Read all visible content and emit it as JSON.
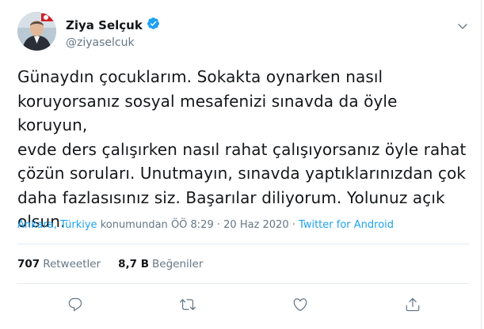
{
  "author": {
    "display_name": "Ziya Selçuk",
    "handle": "@ziyaselcuk",
    "verified": true,
    "avatar_icon": "profile-photo"
  },
  "tweet": {
    "text": "Günaydın çocuklarım. Sokakta oynarken nasıl\nkoruyorsanız sosyal mesafenizi sınavda da öyle koruyun,\nevde ders çalışırken nasıl rahat çalışıyorsanız öyle rahat\nçözün soruları. Unutmayın, sınavda yaptıklarınızdan çok\ndaha fazlasısınız siz. Başarılar diliyorum. Yolunuz açık\nolsun."
  },
  "meta": {
    "location": "Ankara, Türkiye",
    "location_suffix": "konumundan",
    "time": "ÖÖ 8:29",
    "separator": "·",
    "date": "20 Haz 2020",
    "source": "Twitter for Android"
  },
  "stats": {
    "retweets_count": "707",
    "retweets_label": "Retweetler",
    "likes_count": "8,7 B",
    "likes_label": "Beğeniler"
  },
  "colors": {
    "accent": "#1da1f2",
    "muted": "#657786",
    "text": "#14171a",
    "border": "#e6ecf0"
  },
  "icons": [
    "verified-badge-icon",
    "chevron-down-icon",
    "reply-icon",
    "retweet-icon",
    "like-icon",
    "share-icon"
  ]
}
